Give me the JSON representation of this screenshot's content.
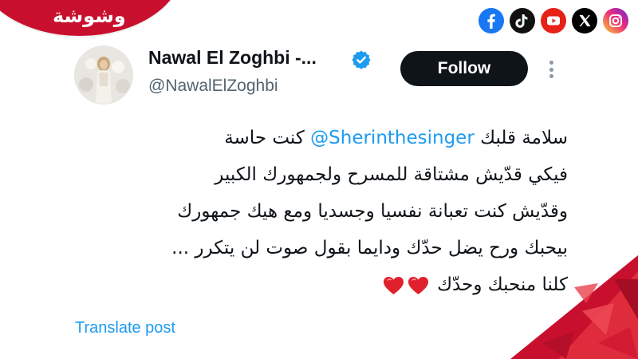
{
  "brand": {
    "logo_text": "وشوشة",
    "color": "#c8102e"
  },
  "social_icons": [
    "facebook-icon",
    "tiktok-icon",
    "youtube-icon",
    "x-icon",
    "instagram-icon"
  ],
  "tweet": {
    "display_name": "Nawal El Zoghbi -...",
    "handle": "@NawalElZoghbi",
    "verified": true,
    "follow_label": "Follow",
    "lines": [
      {
        "before": "سلامة قلبك ",
        "mention": "@Sherinthesinger",
        "after": " كنت حاسة"
      },
      {
        "text": "فيكي قدّيش مشتاقة للمسرح ولجمهورك الكبير"
      },
      {
        "text": "وقدّيش كنت تعبانة نفسيا وجسديا ومع هيك جمهورك"
      },
      {
        "text": "بيحبك ورح يضل حدّك ودايما بقول صوت لن يتكرر ..."
      },
      {
        "text": "كلنا منحبك وحدّك",
        "emoji": "❤️❤️"
      }
    ],
    "translate_label": "Translate post"
  },
  "colors": {
    "link": "#1d9bf0",
    "text": "#0f1419",
    "muted": "#536471",
    "accent_red": "#c8102e"
  }
}
